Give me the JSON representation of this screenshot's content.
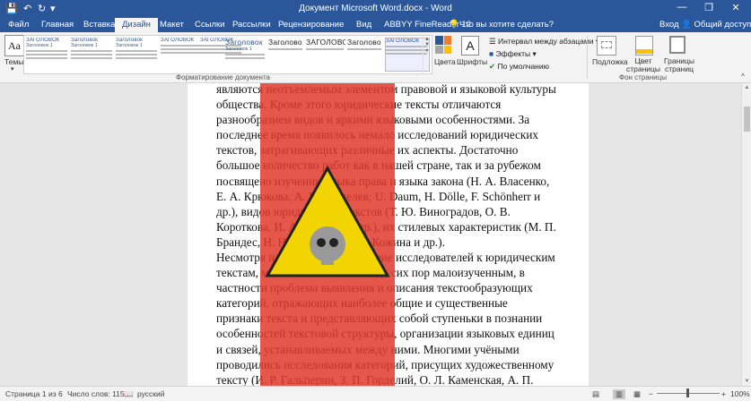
{
  "window": {
    "title": "Документ Microsoft Word.docx - Word",
    "minimize": "—",
    "restore": "❐",
    "close": "✕"
  },
  "quick_access": {
    "save": "💾",
    "undo": "↶",
    "redo": "↻",
    "more": "▾"
  },
  "tabs": [
    "Файл",
    "Главная",
    "Вставка",
    "Дизайн",
    "Макет",
    "Ссылки",
    "Рассылки",
    "Рецензирование",
    "Вид",
    "ABBYY FineReader 12"
  ],
  "tell_me": "Что вы хотите сделать?",
  "signin": "Вход",
  "share": "Общий доступ",
  "ribbon": {
    "themes_label": "Темы",
    "gallery_headings": [
      "ЗАГОЛОВОК",
      "Заголовок",
      "Заголовок",
      "ЗАГОЛОВОК",
      "ЗАГОЛОВОК",
      "Заголовок",
      "Заголовок",
      "Заголовок",
      "ЗАГОЛОВОК",
      "Заголовок",
      "ЗАГОЛОВОК"
    ],
    "gallery_subtitles": [
      "Заголовок 1",
      "Заголовок 1",
      "Заголовок 1",
      "Заголовок 1"
    ],
    "big_styles": [
      "Подложка",
      "Заголово к",
      "ЗАГОЛОВО К",
      "Заголово к"
    ],
    "format_group_caption": "Форматирование документа",
    "colors_label": "Цвета",
    "fonts_label": "Шрифты",
    "fonts_glyph": "A",
    "para_spacing_label": "Интервал между абзацами",
    "effects_label": "Эффекты",
    "default_label": "По умолчанию",
    "watermark_label": "Подложка",
    "page_color_label": "Цвет страницы",
    "page_borders_label": "Границы страниц",
    "page_bg_caption": "Фон страницы"
  },
  "document": {
    "paragraph1": "являются неотъемлемым элементом правовой и языковой культуры общества. Кроме этого юридические тексты отличаются разнообразием видов и яркими языковыми особенностями. За последнее время появилось немало исследований юридических текстов, затрагивающих различные их аспекты. Достаточно большое количество работ как в нашей стране, так и за рубежом посвящено изучению языка права и языка закона (Н. А. Власенко, Е. А. Крюкова, А. Н. Шепелев; U. Daum, H. Dölle, F. Schönherr и др.), видов юридических текстов (Т. Ю. Виноградов, О. В. Короткова, И. А. Улиткин и др.), их стилевых характеристик (М. П. Брандес, Н. Н. Ивакина, М. Н. Кожина и др.).",
    "paragraph2": "Несмотря на постоянное внимание исследователей к юридическим текстам, многое в них остается до сих пор малоизученным, в частности проблема выявления и описания текстообразующих категорий, отражающих наиболее общие и существенные признаки текста и представляющих собой ступеньки в познании особенностей текстовой структуры, организации языковых единиц и связей, устанавливаемых между ними. Многими учёными проводились исследования категорий, присущих художественному тексту (И. Р. Гальперин, З. П. Горделий, О. Л. Каменская, А. П. Кобзева, Е. Ю. Коротенко и др.)"
  },
  "status": {
    "page": "Страница 1 из 6",
    "words": "Число слов: 1153",
    "language": "русский",
    "zoom": "100%",
    "zoom_minus": "−",
    "zoom_plus": "+"
  },
  "colors": {
    "accent": "#2b579a",
    "watermark_red": "#e0392c",
    "watermark_yellow": "#f2d500"
  }
}
